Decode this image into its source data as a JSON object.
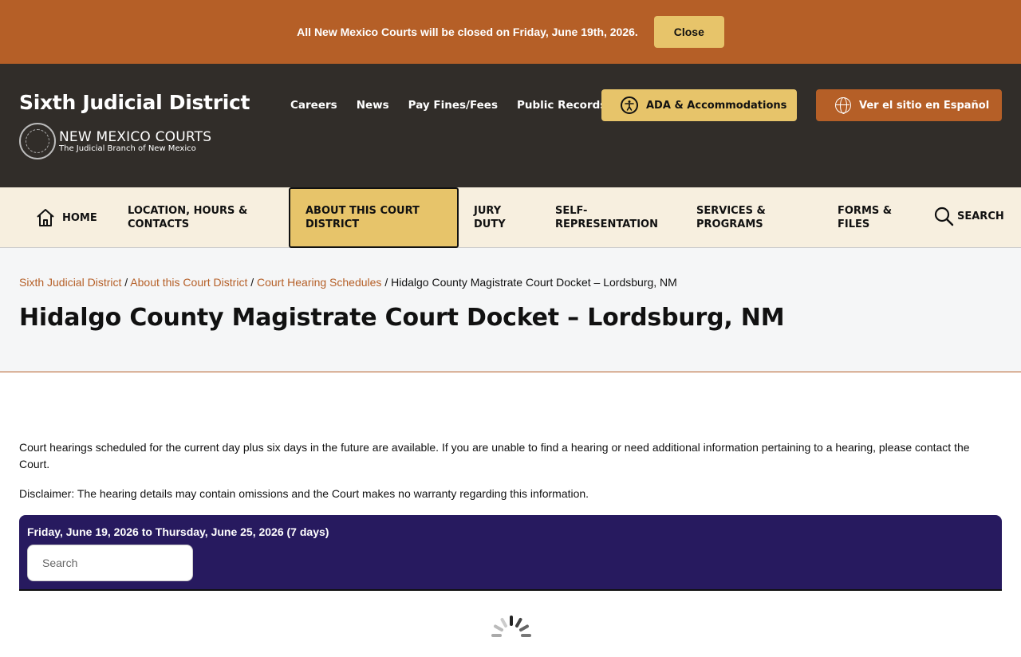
{
  "alert": {
    "text": "All New Mexico Courts will be closed on Friday, June 19th, 2026.",
    "close_label": "Close"
  },
  "header": {
    "site_title": "Sixth Judicial District",
    "brand_name": "NEW MEXICO COURTS",
    "brand_sub": "The Judicial Branch of New Mexico",
    "top_links": [
      "Careers",
      "News",
      "Pay Fines/Fees",
      "Public Records"
    ],
    "ada_label": "ADA & Accommodations",
    "spanish_label": "Ver el sitio en Español"
  },
  "nav": {
    "home": "HOME",
    "location": "LOCATION, HOURS & CONTACTS",
    "about": "ABOUT THIS COURT DISTRICT",
    "jury": "JURY DUTY",
    "self_rep": "SELF-REPRESENTATION",
    "services": "SERVICES & PROGRAMS",
    "forms": "FORMS & FILES",
    "search": "SEARCH"
  },
  "breadcrumb": {
    "items": [
      "Sixth Judicial District",
      "About this Court District",
      "Court Hearing Schedules"
    ],
    "current": "Hidalgo County Magistrate Court Docket – Lordsburg, NM",
    "separator": " / "
  },
  "page": {
    "title": "Hidalgo County Magistrate Court Docket – Lordsburg, NM",
    "intro": "Court hearings scheduled for the current day plus six days in the future are available. If you are unable to find a hearing or need additional information pertaining to a hearing, please contact the Court.",
    "disclaimer": "Disclaimer:  The hearing details may contain omissions and the Court makes no warranty regarding this information."
  },
  "docket": {
    "range": "Friday, June 19, 2026 to Thursday, June 25, 2026 (7 days)",
    "search_placeholder": "Search",
    "search_value": ""
  },
  "colors": {
    "accent": "#b55f27",
    "header_bg": "#312d29",
    "gold": "#e7c46a",
    "nav_bg": "#f7efdf",
    "docket_bg": "#271a5f"
  }
}
